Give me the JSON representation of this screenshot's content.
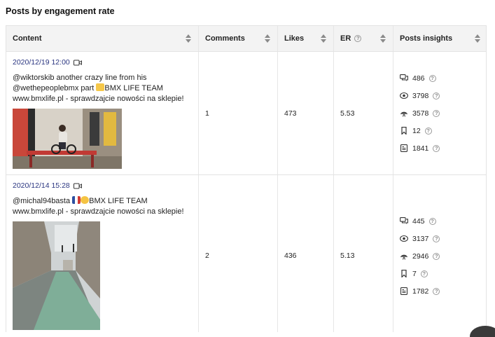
{
  "title": "Posts by engagement rate",
  "columns": {
    "content": "Content",
    "comments": "Comments",
    "likes": "Likes",
    "er": "ER",
    "insights": "Posts insights"
  },
  "posts": [
    {
      "date": "2020/12/19 12:00",
      "caption_line1": "@wiktorskib another crazy line from his",
      "caption_line2_a": "@wethepeoplebmx part ",
      "caption_line2_b": "BMX LIFE TEAM",
      "caption_line3": "www.bmxlife.pl - sprawdzajcie nowości na sklepie!",
      "comments": "1",
      "likes": "473",
      "er": "5.53",
      "insights": [
        "486",
        "3798",
        "3578",
        "12",
        "1841"
      ]
    },
    {
      "date": "2020/12/14 15:28",
      "caption_line1_a": "@michal94basta ",
      "caption_line1_b": "BMX LIFE TEAM",
      "caption_line2": "www.bmxlife.pl - sprawdzajcie nowości na sklepie!",
      "comments": "2",
      "likes": "436",
      "er": "5.13",
      "insights": [
        "445",
        "3137",
        "2946",
        "7",
        "1782"
      ]
    }
  ],
  "insight_icons": [
    "comments-bubble-icon",
    "eye-icon",
    "reach-broadcast-icon",
    "bookmark-icon",
    "engagement-doc-icon"
  ],
  "colors": {
    "date": "#2a3580",
    "header_bg": "#f3f3f3",
    "border": "#e3e3e3"
  }
}
